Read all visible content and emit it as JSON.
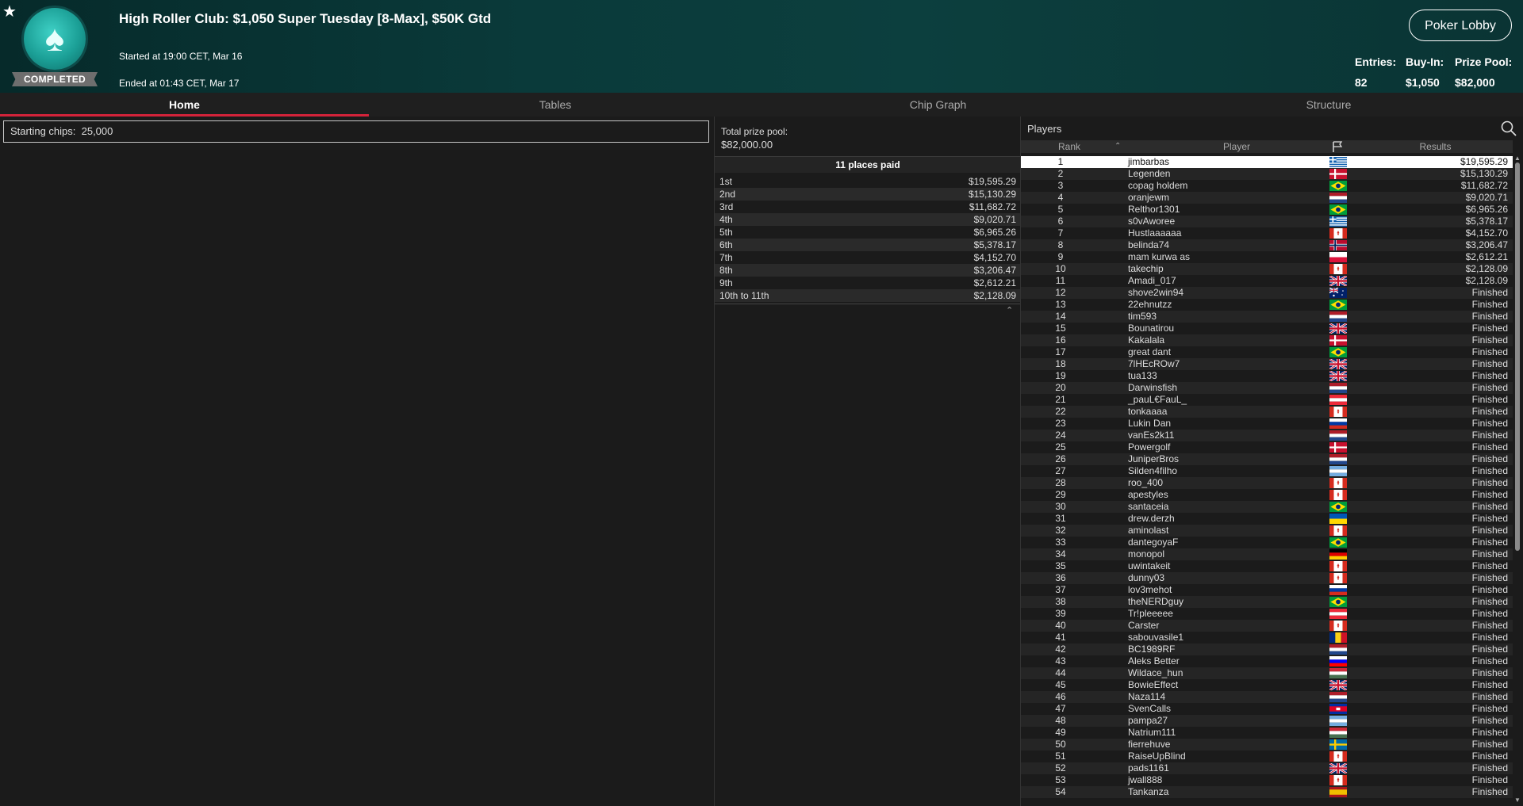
{
  "header": {
    "title": "High Roller Club: $1,050 Super Tuesday [8-Max], $50K Gtd",
    "started": "Started at 19:00 CET, Mar 16",
    "ended": "Ended at 01:43 CET, Mar 17",
    "status": "COMPLETED",
    "lobby_button": "Poker Lobby",
    "stats": {
      "entries_label": "Entries:",
      "entries": "82",
      "buyin_label": "Buy-In:",
      "buyin": "$1,050",
      "prizepool_label": "Prize Pool:",
      "prizepool": "$82,000"
    }
  },
  "tabs": [
    "Home",
    "Tables",
    "Chip Graph",
    "Structure"
  ],
  "home": {
    "starting_chips_label": "Starting chips:",
    "starting_chips": "25,000"
  },
  "prize": {
    "total_label": "Total prize pool:",
    "total": "$82,000.00",
    "places_paid": "11 places paid",
    "payouts": [
      {
        "place": "1st",
        "amount": "$19,595.29"
      },
      {
        "place": "2nd",
        "amount": "$15,130.29"
      },
      {
        "place": "3rd",
        "amount": "$11,682.72"
      },
      {
        "place": "4th",
        "amount": "$9,020.71"
      },
      {
        "place": "5th",
        "amount": "$6,965.26"
      },
      {
        "place": "6th",
        "amount": "$5,378.17"
      },
      {
        "place": "7th",
        "amount": "$4,152.70"
      },
      {
        "place": "8th",
        "amount": "$3,206.47"
      },
      {
        "place": "9th",
        "amount": "$2,612.21"
      },
      {
        "place": "10th to 11th",
        "amount": "$2,128.09"
      }
    ]
  },
  "players": {
    "title": "Players",
    "columns": {
      "rank": "Rank",
      "player": "Player",
      "results": "Results"
    },
    "rows": [
      {
        "rank": "1",
        "name": "jimbarbas",
        "flag": "gr",
        "result": "$19,595.29"
      },
      {
        "rank": "2",
        "name": "Legenden",
        "flag": "dk",
        "result": "$15,130.29"
      },
      {
        "rank": "3",
        "name": "copag holdem",
        "flag": "br",
        "result": "$11,682.72"
      },
      {
        "rank": "4",
        "name": "oranjewm",
        "flag": "nl",
        "result": "$9,020.71"
      },
      {
        "rank": "5",
        "name": "Relthor1301",
        "flag": "br",
        "result": "$6,965.26"
      },
      {
        "rank": "6",
        "name": "s0vAworee",
        "flag": "gr",
        "result": "$5,378.17"
      },
      {
        "rank": "7",
        "name": "Hustlaaaaaa",
        "flag": "ca",
        "result": "$4,152.70"
      },
      {
        "rank": "8",
        "name": "belinda74",
        "flag": "no",
        "result": "$3,206.47"
      },
      {
        "rank": "9",
        "name": "mam kurwa as",
        "flag": "pl",
        "result": "$2,612.21"
      },
      {
        "rank": "10",
        "name": "takechip",
        "flag": "ca",
        "result": "$2,128.09"
      },
      {
        "rank": "11",
        "name": "Amadi_017",
        "flag": "gb",
        "result": "$2,128.09"
      },
      {
        "rank": "12",
        "name": "shove2win94",
        "flag": "au",
        "result": "Finished"
      },
      {
        "rank": "13",
        "name": "22ehnutzz",
        "flag": "br",
        "result": "Finished"
      },
      {
        "rank": "14",
        "name": "tim593",
        "flag": "nl",
        "result": "Finished"
      },
      {
        "rank": "15",
        "name": "Bounatirou",
        "flag": "gb",
        "result": "Finished"
      },
      {
        "rank": "16",
        "name": "Kakalala",
        "flag": "dk",
        "result": "Finished"
      },
      {
        "rank": "17",
        "name": "great dant",
        "flag": "br",
        "result": "Finished"
      },
      {
        "rank": "18",
        "name": "7lHEcROw7",
        "flag": "gb",
        "result": "Finished"
      },
      {
        "rank": "19",
        "name": "tua133",
        "flag": "gb",
        "result": "Finished"
      },
      {
        "rank": "20",
        "name": "Darwinsfish",
        "flag": "nl",
        "result": "Finished"
      },
      {
        "rank": "21",
        "name": "_pauL€FauL_",
        "flag": "at",
        "result": "Finished"
      },
      {
        "rank": "22",
        "name": "tonkaaaa",
        "flag": "ca",
        "result": "Finished"
      },
      {
        "rank": "23",
        "name": "Lukin Dan",
        "flag": "ru",
        "result": "Finished"
      },
      {
        "rank": "24",
        "name": "vanEs2k11",
        "flag": "nl",
        "result": "Finished"
      },
      {
        "rank": "25",
        "name": "Powergolf",
        "flag": "dk",
        "result": "Finished"
      },
      {
        "rank": "26",
        "name": "JuniperBros",
        "flag": "nl",
        "result": "Finished"
      },
      {
        "rank": "27",
        "name": "Silden4filho",
        "flag": "ar",
        "result": "Finished"
      },
      {
        "rank": "28",
        "name": "roo_400",
        "flag": "ca",
        "result": "Finished"
      },
      {
        "rank": "29",
        "name": "apestyles",
        "flag": "ca",
        "result": "Finished"
      },
      {
        "rank": "30",
        "name": "santaceia",
        "flag": "br",
        "result": "Finished"
      },
      {
        "rank": "31",
        "name": "drew.derzh",
        "flag": "ua",
        "result": "Finished"
      },
      {
        "rank": "32",
        "name": "aminolast",
        "flag": "ca",
        "result": "Finished"
      },
      {
        "rank": "33",
        "name": "dantegoyaF",
        "flag": "br",
        "result": "Finished"
      },
      {
        "rank": "34",
        "name": "monopol",
        "flag": "de",
        "result": "Finished"
      },
      {
        "rank": "35",
        "name": "uwintakeit",
        "flag": "ca",
        "result": "Finished"
      },
      {
        "rank": "36",
        "name": "dunny03",
        "flag": "ca",
        "result": "Finished"
      },
      {
        "rank": "37",
        "name": "lov3mehot",
        "flag": "ru",
        "result": "Finished"
      },
      {
        "rank": "38",
        "name": "theNERDguy",
        "flag": "br",
        "result": "Finished"
      },
      {
        "rank": "39",
        "name": "Tr!pleeeee",
        "flag": "at",
        "result": "Finished"
      },
      {
        "rank": "40",
        "name": "Carster",
        "flag": "ca",
        "result": "Finished"
      },
      {
        "rank": "41",
        "name": "sabouvasile1",
        "flag": "ro",
        "result": "Finished"
      },
      {
        "rank": "42",
        "name": "BC1989RF",
        "flag": "nl",
        "result": "Finished"
      },
      {
        "rank": "43",
        "name": "Aleks Better",
        "flag": "si",
        "result": "Finished"
      },
      {
        "rank": "44",
        "name": "Wildace_hun",
        "flag": "hu",
        "result": "Finished"
      },
      {
        "rank": "45",
        "name": "BowieEffect",
        "flag": "gb",
        "result": "Finished"
      },
      {
        "rank": "46",
        "name": "Naza114",
        "flag": "nl",
        "result": "Finished"
      },
      {
        "rank": "47",
        "name": "SvenCalls",
        "flag": "kh",
        "result": "Finished"
      },
      {
        "rank": "48",
        "name": "pampa27",
        "flag": "ar",
        "result": "Finished"
      },
      {
        "rank": "49",
        "name": "Natrium111",
        "flag": "hu",
        "result": "Finished"
      },
      {
        "rank": "50",
        "name": "fierrehuve",
        "flag": "se",
        "result": "Finished"
      },
      {
        "rank": "51",
        "name": "RaiseUpBlind",
        "flag": "ca",
        "result": "Finished"
      },
      {
        "rank": "52",
        "name": "pads1161",
        "flag": "gb",
        "result": "Finished"
      },
      {
        "rank": "53",
        "name": "jwall888",
        "flag": "ca",
        "result": "Finished"
      },
      {
        "rank": "54",
        "name": "Tankanza",
        "flag": "es",
        "result": "Finished"
      }
    ]
  },
  "colors": {
    "accent": "#d4233a",
    "header_bg": "#0a3a3a",
    "selected_row": "#ffffff"
  }
}
